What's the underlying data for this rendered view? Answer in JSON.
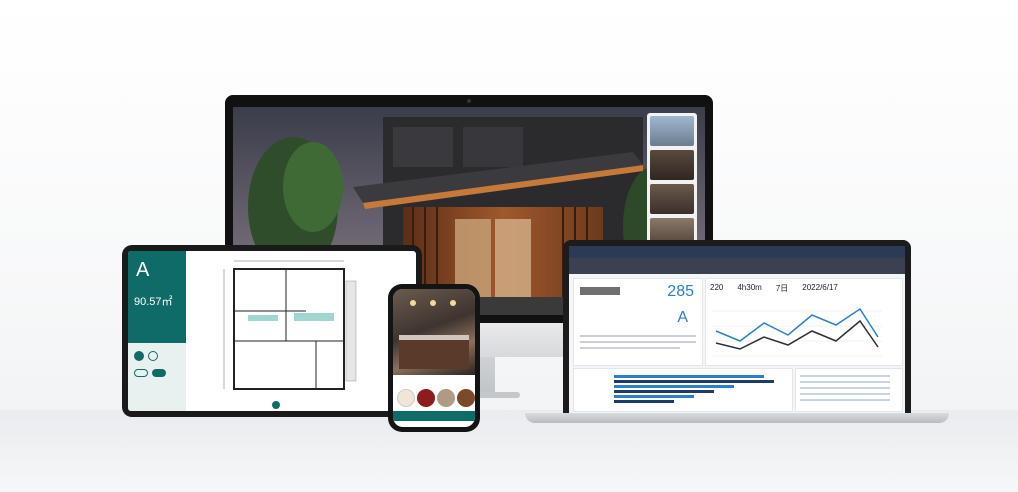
{
  "tablet": {
    "unit_letter": "A",
    "area": "90.57㎡"
  },
  "laptop": {
    "dashboard_big_number": "285",
    "dashboard_grade": "A",
    "stats": [
      "220",
      "4h30m",
      "7日",
      "2022/6/17"
    ]
  },
  "colors": {
    "accent_teal": "#0f6b67",
    "chart_blue": "#2a7fc9",
    "chart_navy": "#1d3a6b"
  }
}
